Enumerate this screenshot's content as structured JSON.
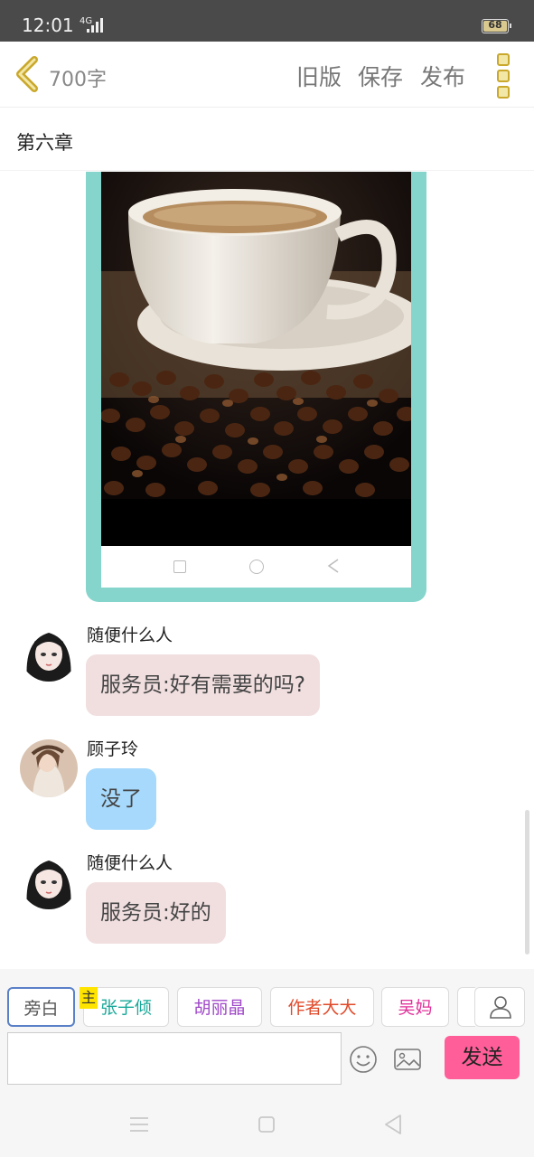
{
  "status_bar": {
    "time": "12:01",
    "network": "4G",
    "battery": "68"
  },
  "header": {
    "word_count": "700字",
    "old_version": "旧版",
    "save": "保存",
    "publish": "发布"
  },
  "chapter": {
    "title": "第六章"
  },
  "messages": [
    {
      "sender": "随便什么人",
      "text": "服务员:好有需要的吗?",
      "style": "pink"
    },
    {
      "sender": "顾子玲",
      "text": "没了",
      "style": "blue"
    },
    {
      "sender": "随便什么人",
      "text": "服务员:好的",
      "style": "pink"
    }
  ],
  "characters": [
    {
      "name": "旁白",
      "color": "#555555"
    },
    {
      "name": "张子倾",
      "color": "#1aa99a",
      "main_badge": "主"
    },
    {
      "name": "胡丽晶",
      "color": "#a048c8"
    },
    {
      "name": "作者大大",
      "color": "#e04a2a"
    },
    {
      "name": "吴妈",
      "color": "#e0309a"
    }
  ],
  "composer": {
    "send_label": "发送",
    "placeholder": ""
  },
  "colors": {
    "send_button": "#ff5e98",
    "phone_frame": "#86d5cc",
    "pink_bubble": "#f1dfe0",
    "blue_bubble": "#a6d9fb"
  }
}
